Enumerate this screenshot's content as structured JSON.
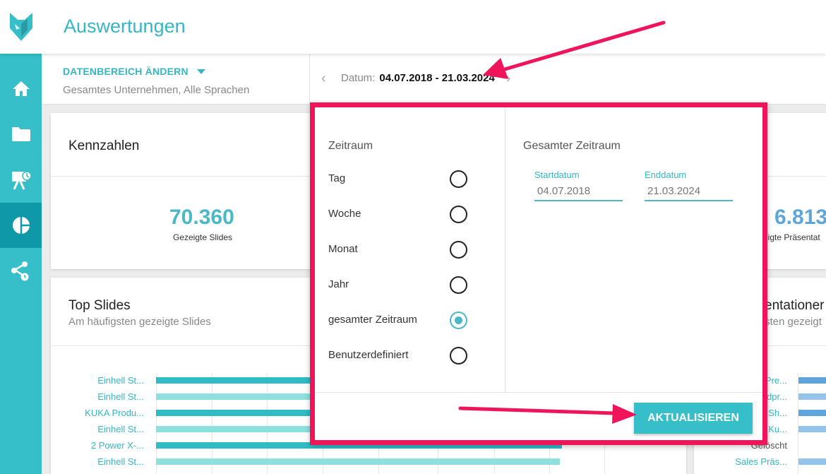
{
  "header": {
    "title": "Auswertungen"
  },
  "sidebar": {
    "items": [
      {
        "icon": "home-icon"
      },
      {
        "icon": "folder-icon"
      },
      {
        "icon": "presentation-icon"
      },
      {
        "icon": "pie-chart-icon",
        "active": true
      },
      {
        "icon": "share-icon"
      }
    ]
  },
  "filter": {
    "label": "DATENBEREICH ÄNDERN",
    "scope": "Gesamtes Unternehmen, Alle Sprachen",
    "date_label": "Datum:",
    "date_value": "04.07.2018 - 21.03.2024"
  },
  "kennzahlen": {
    "title": "Kennzahlen",
    "kpis": [
      {
        "value": "70.360",
        "label": "Gezeigte Slides"
      },
      {
        "value": "6.813",
        "label": "eigte Präsentat"
      }
    ]
  },
  "top_slides": {
    "title": "Top Slides",
    "subtitle": "Am häufigsten gezeigte Slides",
    "bars": [
      {
        "label": "Einhell St...",
        "value": 100,
        "color": "#2fbcc5"
      },
      {
        "label": "Einhell St...",
        "value": 100,
        "color": "#8ee0de"
      },
      {
        "label": "KUKA Produ...",
        "value": 100,
        "color": "#2fbcc5"
      },
      {
        "label": "Einhell St...",
        "value": 100,
        "color": "#8ee0de"
      },
      {
        "label": "2 Power X-...",
        "value": 100,
        "color": "#2fbcc5"
      },
      {
        "label": "Einhell St...",
        "value": 100,
        "color": "#8ee0de"
      }
    ]
  },
  "top_presentations": {
    "title": "entationer",
    "subtitle": "sten gezeigt",
    "labels": [
      "Pre...",
      "dpr...",
      "Sh...",
      "Ku...",
      "Gelöscht",
      "Sales Präs..."
    ],
    "colors": [
      "#5ea5dc",
      "#93c3ea",
      "#5ea5dc",
      "#93c3ea",
      "#5ea5dc",
      "#93c3ea"
    ]
  },
  "popup": {
    "zeitraum_title": "Zeitraum",
    "options": [
      {
        "label": "Tag",
        "checked": false
      },
      {
        "label": "Woche",
        "checked": false
      },
      {
        "label": "Monat",
        "checked": false
      },
      {
        "label": "Jahr",
        "checked": false
      },
      {
        "label": "gesamter Zeitraum",
        "checked": true
      },
      {
        "label": "Benutzerdefiniert",
        "checked": false
      }
    ],
    "range_title": "Gesamter Zeitraum",
    "start_label": "Startdatum",
    "start_value": "04.07.2018",
    "end_label": "Enddatum",
    "end_value": "21.03.2024",
    "button_label": "AKTUALISIEREN"
  },
  "colors": {
    "accent": "#36bfc9",
    "highlight": "#f0145a"
  }
}
